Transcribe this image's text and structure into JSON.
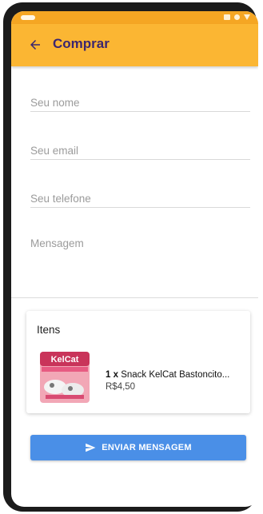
{
  "appbar": {
    "title": "Comprar"
  },
  "form": {
    "name_placeholder": "Seu nome",
    "email_placeholder": "Seu email",
    "phone_placeholder": "Seu telefone",
    "message_placeholder": "Mensagem"
  },
  "cart": {
    "title": "Itens",
    "items": [
      {
        "quantity": "1 x",
        "name": "Snack KelCat Bastoncito...",
        "price": "R$4,50",
        "image_brand": "KelCat"
      }
    ]
  },
  "actions": {
    "send_label": "ENVIAR MENSAGEM"
  },
  "colors": {
    "appbar": "#fbb633",
    "statusbar": "#f5a623",
    "title": "#3b2670",
    "button": "#4a8fe7"
  },
  "icons": {
    "back": "arrow-left-icon",
    "send": "send-icon"
  }
}
